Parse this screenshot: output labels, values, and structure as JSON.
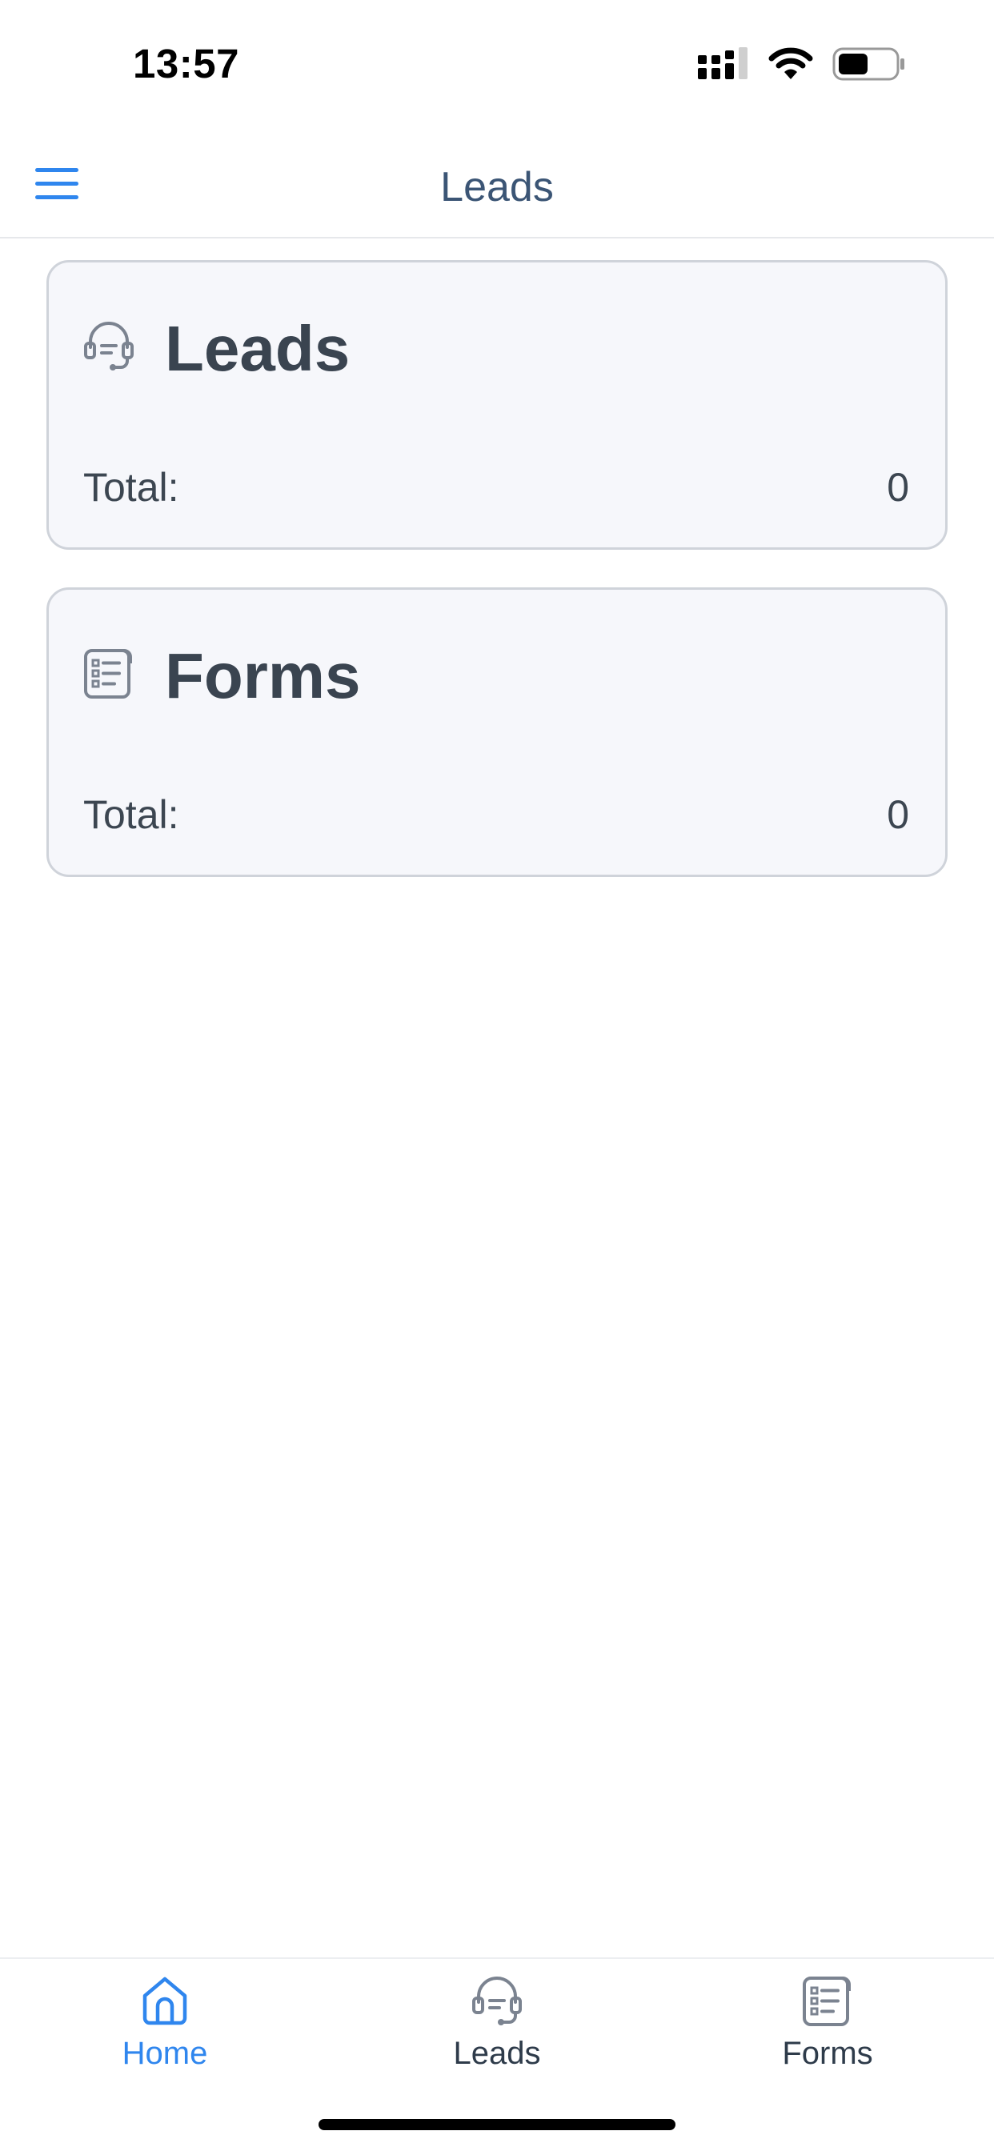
{
  "status_bar": {
    "time": "13:57",
    "icons": [
      "signal-icon",
      "wifi-icon",
      "battery-icon"
    ]
  },
  "header": {
    "menu_icon": "hamburger-menu-icon",
    "title": "Leads"
  },
  "cards": [
    {
      "icon": "headset-icon",
      "title": "Leads",
      "total_label": "Total:",
      "total_value": "0"
    },
    {
      "icon": "form-document-icon",
      "title": "Forms",
      "total_label": "Total:",
      "total_value": "0"
    }
  ],
  "tab_bar": {
    "tabs": [
      {
        "label": "Home",
        "icon": "home-icon",
        "active": true
      },
      {
        "label": "Leads",
        "icon": "headset-icon",
        "active": false
      },
      {
        "label": "Forms",
        "icon": "form-document-icon",
        "active": false
      }
    ]
  },
  "colors": {
    "accent": "#2f86ee",
    "title_text": "#3b5575",
    "card_bg": "#f6f7fb",
    "card_border": "#cfd3da",
    "text_dark": "#3a4450"
  }
}
